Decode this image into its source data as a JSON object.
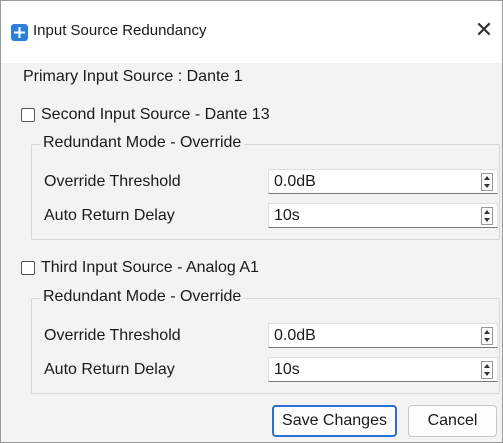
{
  "window": {
    "title": "Input Source Redundancy",
    "close_glyph": "✕",
    "app_icon": "app-icon",
    "close_icon": "close-icon"
  },
  "primary": {
    "label": "Primary Input Source : Dante 1"
  },
  "second": {
    "checkbox_label": "Second Input Source - Dante 13",
    "checked": false,
    "group_title": "Redundant Mode - Override",
    "threshold_label": "Override Threshold",
    "threshold_value": "0.0dB",
    "delay_label": "Auto Return Delay",
    "delay_value": "10s"
  },
  "third": {
    "checkbox_label": "Third Input Source - Analog  A1",
    "checked": false,
    "group_title": "Redundant Mode - Override",
    "threshold_label": "Override Threshold",
    "threshold_value": "0.0dB",
    "delay_label": "Auto Return Delay",
    "delay_value": "10s"
  },
  "buttons": {
    "save": "Save Changes",
    "cancel": "Cancel"
  },
  "colors": {
    "accent": "#2a6fd1",
    "icon": "#2e7fd9"
  }
}
